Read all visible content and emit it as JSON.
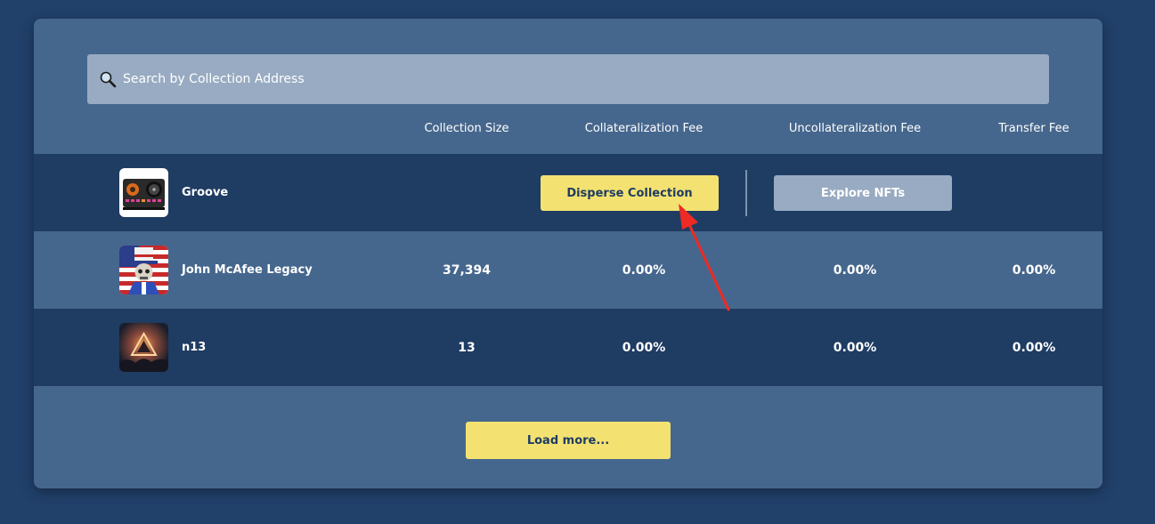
{
  "search": {
    "placeholder": "Search by Collection Address",
    "icon": "search-icon"
  },
  "columns": [
    "Collection Size",
    "Collateralization Fee",
    "Uncollateralization Fee",
    "Transfer Fee"
  ],
  "rows": [
    {
      "name": "Groove",
      "avatar_icon": "dj-turntable-icon",
      "actions": {
        "disperse_label": "Disperse Collection",
        "explore_label": "Explore NFTs"
      }
    },
    {
      "name": "John McAfee Legacy",
      "avatar_icon": "uncle-sam-skeleton-icon",
      "size": "37,394",
      "collateralization_fee": "0.00%",
      "uncollateralization_fee": "0.00%",
      "transfer_fee": "0.00%"
    },
    {
      "name": "n13",
      "avatar_icon": "fiery-pyramid-icon",
      "size": "13",
      "collateralization_fee": "0.00%",
      "uncollateralization_fee": "0.00%",
      "transfer_fee": "0.00%"
    }
  ],
  "load_more_label": "Load more...",
  "colors": {
    "background": "#21406a",
    "panel": "#46678d",
    "row_dark": "#1f3c63",
    "accent_yellow": "#f3e271",
    "muted_button": "#98abc2",
    "annotation_arrow": "#ee2a24"
  }
}
